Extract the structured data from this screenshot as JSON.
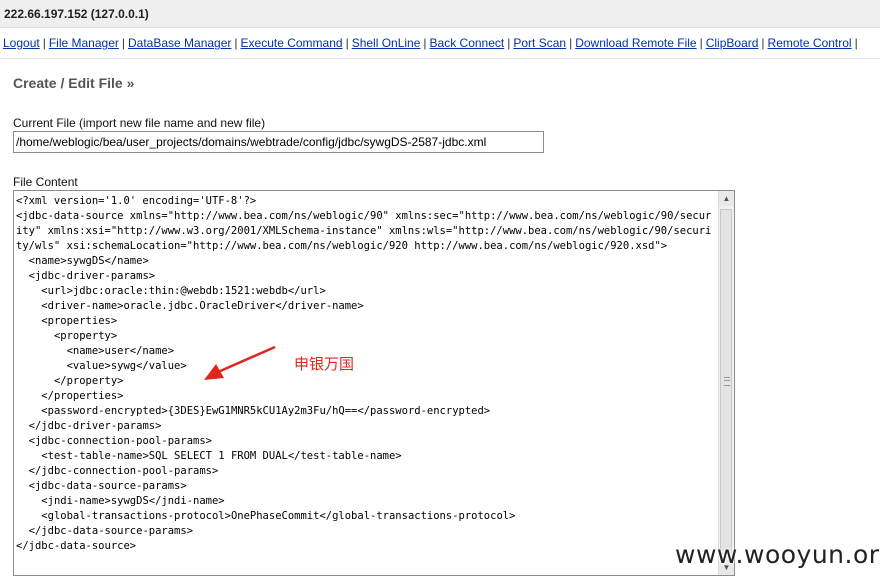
{
  "header": {
    "host": "222.66.197.152 (127.0.0.1)"
  },
  "nav": {
    "items": [
      {
        "label": "Logout"
      },
      {
        "label": "File Manager"
      },
      {
        "label": "DataBase Manager"
      },
      {
        "label": "Execute Command"
      },
      {
        "label": "Shell OnLine"
      },
      {
        "label": "Back Connect"
      },
      {
        "label": "Port Scan"
      },
      {
        "label": "Download Remote File"
      },
      {
        "label": "ClipBoard"
      },
      {
        "label": "Remote Control"
      }
    ],
    "separator": "|"
  },
  "page": {
    "section_title": "Create / Edit File »",
    "current_file_label": "Current File (import new file name and new file)",
    "current_file_value": "/home/weblogic/bea/user_projects/domains/webtrade/config/jdbc/sywgDS-2587-jdbc.xml",
    "file_content_label": "File Content",
    "file_content": "<?xml version='1.0' encoding='UTF-8'?>\n<jdbc-data-source xmlns=\"http://www.bea.com/ns/weblogic/90\" xmlns:sec=\"http://www.bea.com/ns/weblogic/90/security\" xmlns:xsi=\"http://www.w3.org/2001/XMLSchema-instance\" xmlns:wls=\"http://www.bea.com/ns/weblogic/90/security/wls\" xsi:schemaLocation=\"http://www.bea.com/ns/weblogic/920 http://www.bea.com/ns/weblogic/920.xsd\">\n  <name>sywgDS</name>\n  <jdbc-driver-params>\n    <url>jdbc:oracle:thin:@webdb:1521:webdb</url>\n    <driver-name>oracle.jdbc.OracleDriver</driver-name>\n    <properties>\n      <property>\n        <name>user</name>\n        <value>sywg</value>\n      </property>\n    </properties>\n    <password-encrypted>{3DES}EwG1MNR5kCU1Ay2m3Fu/hQ==</password-encrypted>\n  </jdbc-driver-params>\n  <jdbc-connection-pool-params>\n    <test-table-name>SQL SELECT 1 FROM DUAL</test-table-name>\n  </jdbc-connection-pool-params>\n  <jdbc-data-source-params>\n    <jndi-name>sywgDS</jndi-name>\n    <global-transactions-protocol>OnePhaseCommit</global-transactions-protocol>\n  </jdbc-data-source-params>\n</jdbc-data-source>"
  },
  "annotation": {
    "text": "申银万国",
    "color": "#e0261c"
  },
  "watermark": {
    "text": "www.wooyun.org"
  },
  "colors": {
    "link": "#0033aa",
    "topbar_bg": "#efefef",
    "section_title": "#555555"
  }
}
